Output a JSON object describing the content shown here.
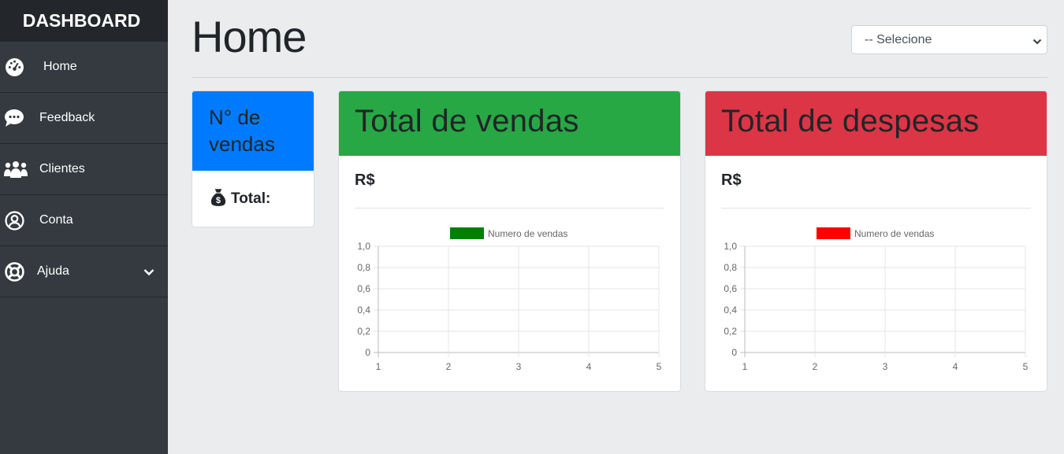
{
  "sidebar": {
    "brand": "DASHBOARD",
    "items": [
      {
        "label": "Home",
        "icon": "dashboard-gauge-icon"
      },
      {
        "label": "Feedback",
        "icon": "comment-dots-icon"
      },
      {
        "label": "Clientes",
        "icon": "users-icon"
      },
      {
        "label": "Conta",
        "icon": "user-circle-icon"
      },
      {
        "label": "Ajuda",
        "icon": "life-ring-icon"
      }
    ]
  },
  "header": {
    "title": "Home",
    "select_value": "-- Selecione"
  },
  "cards": {
    "count": {
      "title": "N° de vendas",
      "total_label": "Total:"
    },
    "sales": {
      "title": "Total de vendas",
      "currency": "R$"
    },
    "expenses": {
      "title": "Total de despesas",
      "currency": "R$"
    }
  },
  "colors": {
    "blue": "#007bff",
    "green": "#28a745",
    "red": "#dc3545",
    "sales_series": "#008000",
    "expense_series": "#ff0000"
  },
  "chart_data": [
    {
      "type": "bar",
      "categories": [
        "1",
        "2",
        "3",
        "4",
        "5"
      ],
      "series": [
        {
          "name": "Numero de vendas",
          "values": [],
          "color": "#008000"
        }
      ],
      "ylim": [
        0,
        1
      ],
      "yticks": [
        "1,0",
        "0,8",
        "0,6",
        "0,4",
        "0,2",
        "0"
      ],
      "grid": true,
      "legend": "top"
    },
    {
      "type": "bar",
      "categories": [
        "1",
        "2",
        "3",
        "4",
        "5"
      ],
      "series": [
        {
          "name": "Numero de vendas",
          "values": [],
          "color": "#ff0000"
        }
      ],
      "ylim": [
        0,
        1
      ],
      "yticks": [
        "1,0",
        "0,8",
        "0,6",
        "0,4",
        "0,2",
        "0"
      ],
      "grid": true,
      "legend": "top"
    }
  ]
}
